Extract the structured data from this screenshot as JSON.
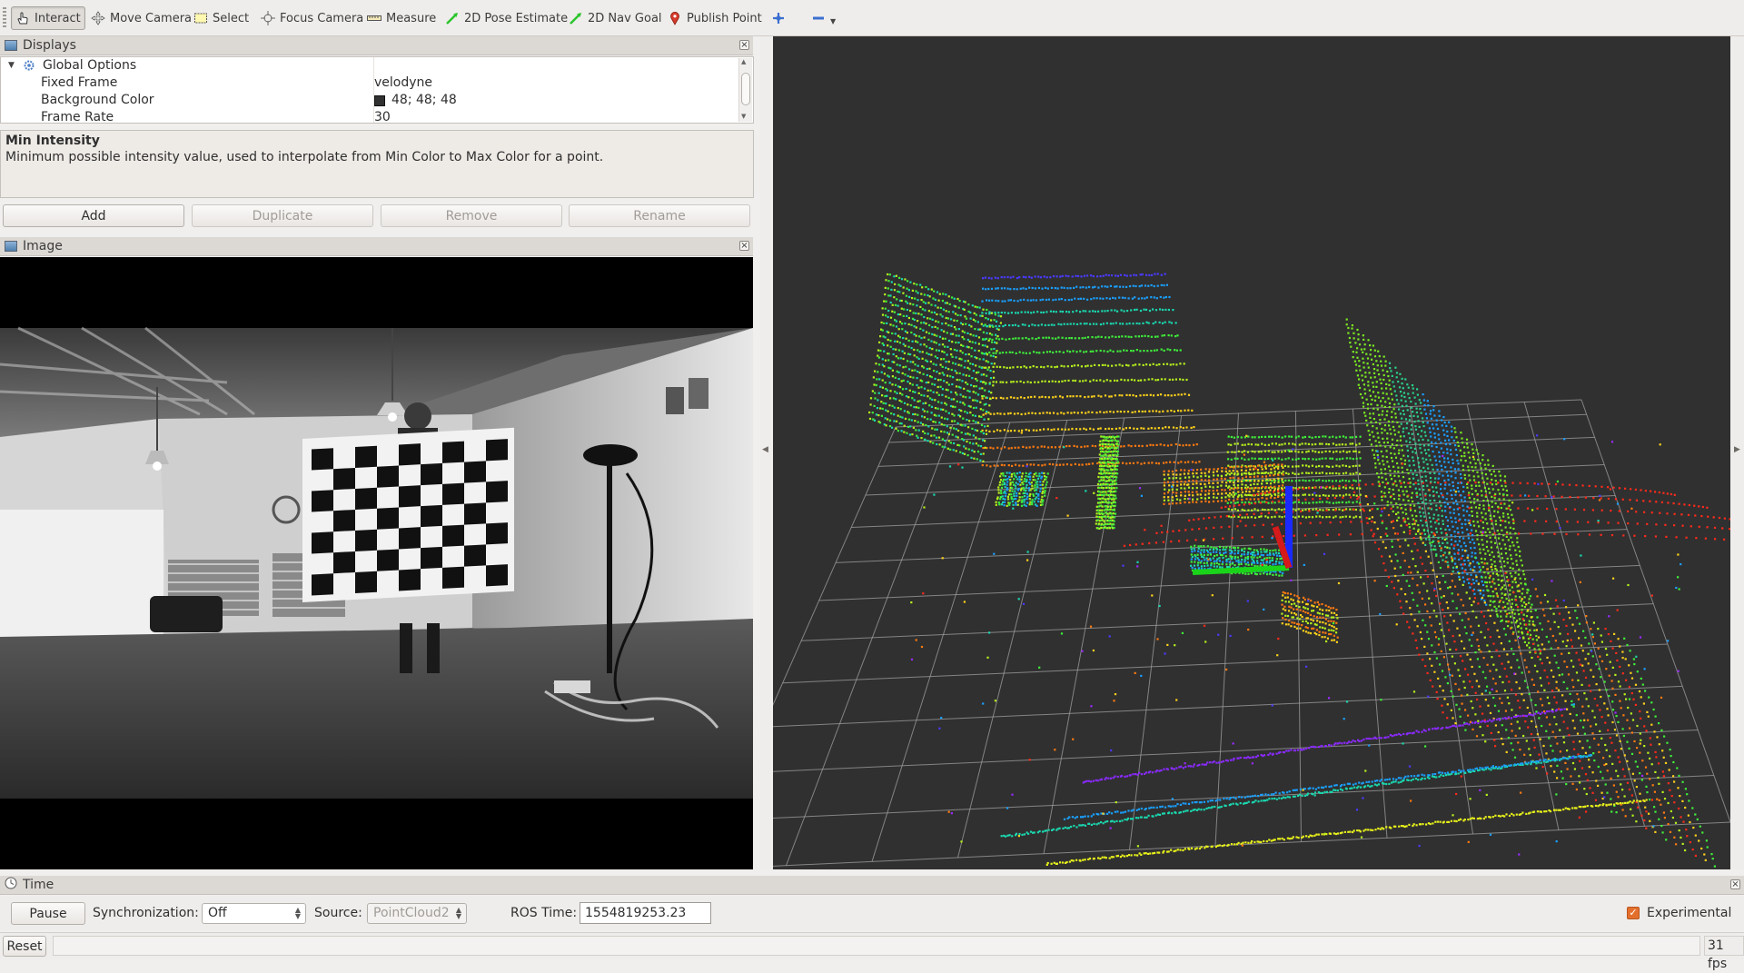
{
  "toolbar": {
    "tools": [
      {
        "label": "Interact",
        "icon": "hand-cursor-icon",
        "active": true
      },
      {
        "label": "Move Camera",
        "icon": "move-arrows-icon"
      },
      {
        "label": "Select",
        "icon": "select-box-icon"
      },
      {
        "label": "Focus Camera",
        "icon": "focus-crosshair-icon"
      },
      {
        "label": "Measure",
        "icon": "ruler-icon"
      },
      {
        "label": "2D Pose Estimate",
        "icon": "green-arrow-icon"
      },
      {
        "label": "2D Nav Goal",
        "icon": "green-arrow-icon"
      },
      {
        "label": "Publish Point",
        "icon": "map-pin-icon"
      }
    ]
  },
  "displays_panel": {
    "title": "Displays",
    "tree": {
      "group_label": "Global Options",
      "rows": [
        {
          "name": "Fixed Frame",
          "value": "velodyne"
        },
        {
          "name": "Background Color",
          "value": "48; 48; 48",
          "swatch": "#303030"
        },
        {
          "name": "Frame Rate",
          "value": "30"
        }
      ]
    },
    "description": {
      "title": "Min Intensity",
      "text": "Minimum possible intensity value, used to interpolate from Min Color to Max Color for a point."
    },
    "buttons": {
      "add": "Add",
      "duplicate": "Duplicate",
      "remove": "Remove",
      "rename": "Rename"
    }
  },
  "image_panel": {
    "title": "Image"
  },
  "time_panel": {
    "title": "Time",
    "pause_label": "Pause",
    "sync_label": "Synchronization:",
    "sync_value": "Off",
    "source_label": "Source:",
    "source_value": "PointCloud2",
    "ros_time_label": "ROS Time:",
    "ros_time_value": "1554819253.23",
    "experimental_label": "Experimental",
    "experimental_checked": true
  },
  "status_bar": {
    "reset_label": "Reset",
    "fps": "31 fps"
  },
  "colors": {
    "background_3d": "#303030",
    "grid": "#a0a0a0",
    "accent": "#e46f2d"
  }
}
